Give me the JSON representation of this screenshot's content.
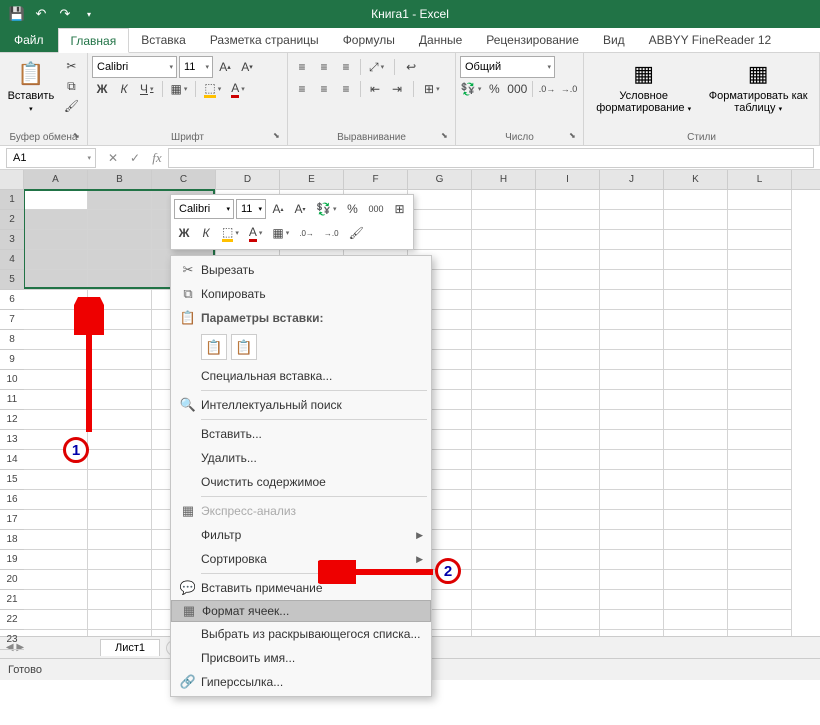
{
  "app": {
    "title": "Книга1 - Excel"
  },
  "qat": {
    "save": "💾",
    "undo": "↶",
    "redo": "↷"
  },
  "tabs": {
    "file": "Файл",
    "items": [
      "Главная",
      "Вставка",
      "Разметка страницы",
      "Формулы",
      "Данные",
      "Рецензирование",
      "Вид",
      "ABBYY FineReader 12"
    ],
    "activeIndex": 0
  },
  "ribbon": {
    "clipboard": {
      "paste": "Вставить",
      "label": "Буфер обмена"
    },
    "font": {
      "name": "Calibri",
      "size": "11",
      "bold": "Ж",
      "italic": "К",
      "underline": "Ч",
      "label": "Шрифт"
    },
    "alignment": {
      "label": "Выравнивание"
    },
    "number": {
      "format": "Общий",
      "label": "Число"
    },
    "styles": {
      "cond": "Условное форматирование",
      "table": "Форматировать как таблицу",
      "label": "Стили"
    }
  },
  "formula": {
    "cell_ref": "A1"
  },
  "grid": {
    "columns": [
      "A",
      "B",
      "C",
      "D",
      "E",
      "F",
      "G",
      "H",
      "I",
      "J",
      "K",
      "L"
    ],
    "rows": [
      "1",
      "2",
      "3",
      "4",
      "5",
      "6",
      "7",
      "8",
      "9",
      "10",
      "11",
      "12",
      "13",
      "14",
      "15",
      "16",
      "17",
      "18",
      "19",
      "20",
      "21",
      "22",
      "23"
    ],
    "selected_cols": [
      "A",
      "B",
      "C"
    ],
    "selected_rows": [
      "1",
      "2",
      "3",
      "4",
      "5"
    ],
    "active_cell": "A1"
  },
  "sheets": {
    "tab1": "Лист1"
  },
  "status": {
    "ready": "Готово"
  },
  "mini_toolbar": {
    "font": "Calibri",
    "size": "11"
  },
  "context_menu": {
    "cut": "Вырезать",
    "copy": "Копировать",
    "paste_options": "Параметры вставки:",
    "paste_special": "Специальная вставка...",
    "smart_lookup": "Интеллектуальный поиск",
    "insert": "Вставить...",
    "delete": "Удалить...",
    "clear": "Очистить содержимое",
    "quick_analysis": "Экспресс-анализ",
    "filter": "Фильтр",
    "sort": "Сортировка",
    "comment": "Вставить примечание",
    "format_cells": "Формат ячеек...",
    "pick_list": "Выбрать из раскрывающегося списка...",
    "define_name": "Присвоить имя...",
    "hyperlink": "Гиперссылка..."
  },
  "annotations": {
    "one": "1",
    "two": "2"
  }
}
